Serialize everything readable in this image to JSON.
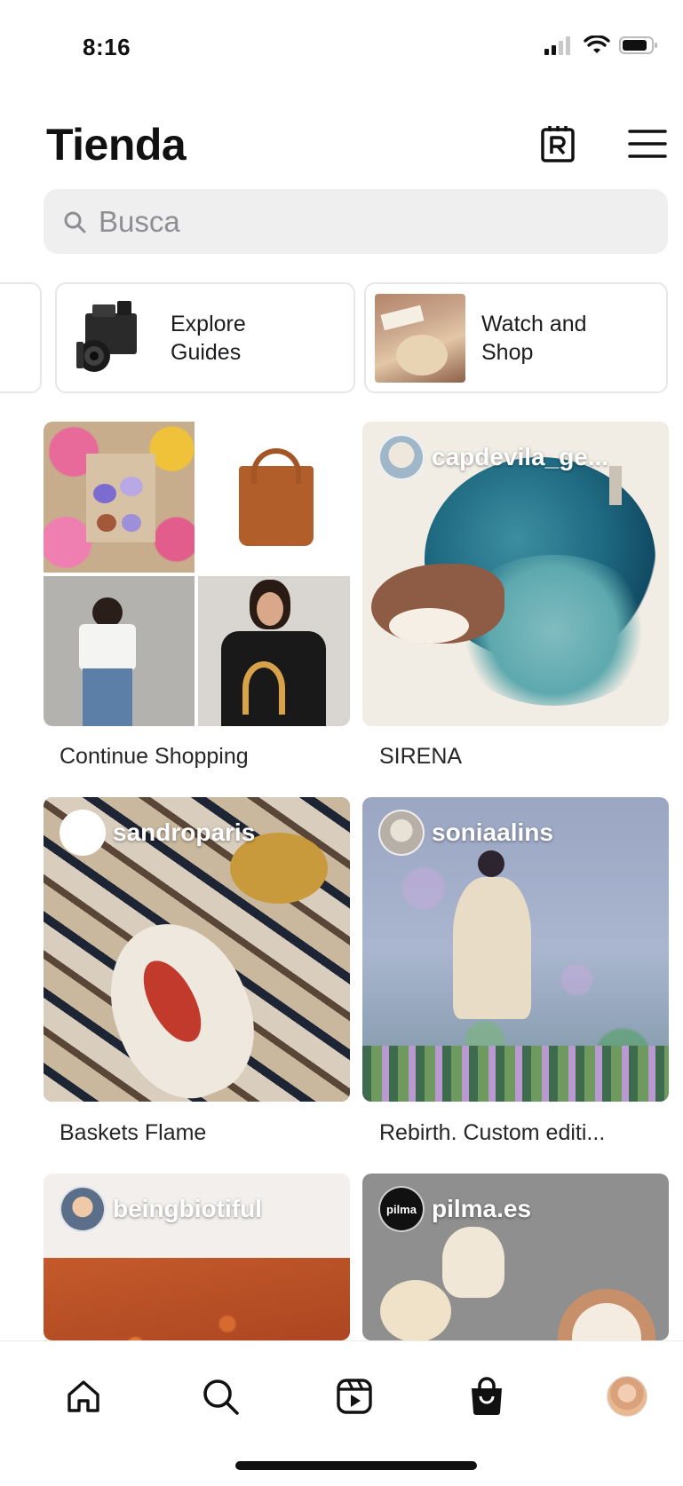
{
  "status_bar": {
    "time": "8:16"
  },
  "header": {
    "title": "Tienda"
  },
  "search": {
    "placeholder": "Busca"
  },
  "chips": [
    {
      "label_line1": "Explore",
      "label_line2": "Guides"
    },
    {
      "label_line1": "Watch and",
      "label_line2": "Shop"
    }
  ],
  "cards": [
    {
      "caption": "Continue Shopping"
    },
    {
      "handle": "capdevila_ge...",
      "caption": "SIRENA"
    },
    {
      "handle": "sandroparis",
      "caption": "Baskets Flame"
    },
    {
      "handle": "soniaalins",
      "caption": "Rebirth. Custom editi..."
    },
    {
      "handle": "beingbiotiful"
    },
    {
      "handle": "pilma.es",
      "avatar_text": "pilma"
    }
  ],
  "tab_bar": {
    "items": [
      "home-icon",
      "search-icon",
      "reels-icon",
      "shop-icon",
      "profile-avatar"
    ],
    "active": "shop-icon"
  }
}
